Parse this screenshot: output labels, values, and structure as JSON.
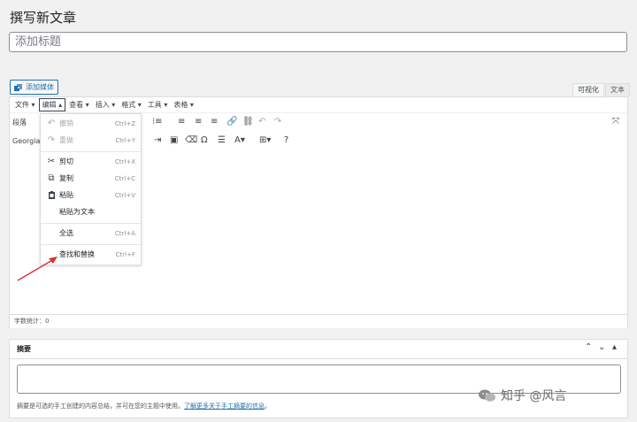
{
  "page": {
    "heading": "撰写新文章"
  },
  "title_field": {
    "placeholder": "添加标题"
  },
  "media": {
    "add_label": "添加媒体"
  },
  "mode_tabs": {
    "visual": "可视化",
    "text": "文本"
  },
  "menubar": {
    "items": [
      "文件 ▾",
      "编辑 ▴",
      "查看 ▾",
      "插入 ▾",
      "格式 ▾",
      "工具 ▾",
      "表格 ▾"
    ]
  },
  "toolbar": {
    "paragraph_select": "段落",
    "font_select": "Georgia"
  },
  "edit_menu": {
    "items": [
      {
        "label": "撤销",
        "shortcut": "Ctrl+Z",
        "icon": "undo-icon",
        "glyph": "↶"
      },
      {
        "label": "重做",
        "shortcut": "Ctrl+Y",
        "icon": "redo-icon",
        "glyph": "↷"
      },
      {
        "label": "剪切",
        "shortcut": "Ctrl+X",
        "icon": "scissors-icon",
        "glyph": "✂"
      },
      {
        "label": "复制",
        "shortcut": "Ctrl+C",
        "icon": "copy-icon",
        "glyph": "⧉"
      },
      {
        "label": "粘贴",
        "shortcut": "Ctrl+V",
        "icon": "paste-icon",
        "glyph": "📋"
      },
      {
        "label": "粘贴为文本",
        "shortcut": "",
        "icon": "",
        "glyph": ""
      },
      {
        "label": "全选",
        "shortcut": "Ctrl+A",
        "icon": "",
        "glyph": ""
      },
      {
        "label": "查找和替换",
        "shortcut": "Ctrl+F",
        "icon": "",
        "glyph": ""
      }
    ]
  },
  "status": {
    "word_count": "字数统计：0"
  },
  "excerpt": {
    "title": "摘要",
    "help_text": "摘要是可选的手工创建的内容总结，并可在您的主题中使用。",
    "help_link": "了解更多关于手工摘要的信息",
    "help_end": "。"
  },
  "watermark": {
    "text": "知乎 @风言"
  }
}
